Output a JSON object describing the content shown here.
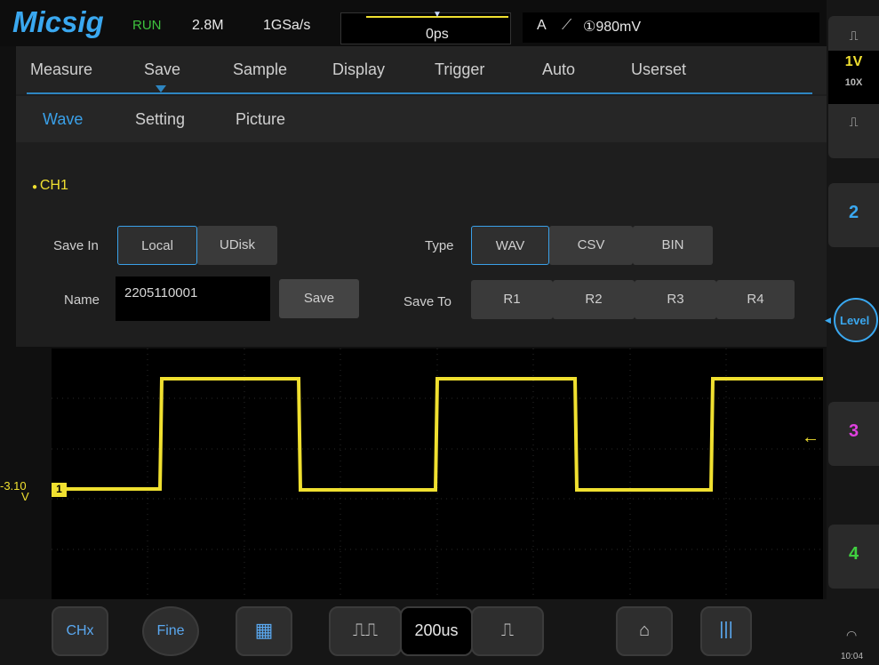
{
  "status": {
    "brand": "Micsig",
    "run_state": "RUN",
    "memory_depth": "2.8M",
    "sample_rate": "1GSa/s",
    "time_offset": "0ps",
    "trigger_source": "A",
    "trigger_level": "①980mV"
  },
  "menu": {
    "tabs": [
      "Measure",
      "Save",
      "Sample",
      "Display",
      "Trigger",
      "Auto",
      "Userset"
    ],
    "subtabs": [
      "Wave",
      "Setting",
      "Picture"
    ]
  },
  "save_panel": {
    "channel": "CH1",
    "save_in_label": "Save In",
    "save_in_options": [
      "Local",
      "UDisk"
    ],
    "type_label": "Type",
    "type_options": [
      "WAV",
      "CSV",
      "BIN"
    ],
    "name_label": "Name",
    "name_value": "2205110001",
    "save_button": "Save",
    "save_to_label": "Save To",
    "save_to_options": [
      "R1",
      "R2",
      "R3",
      "R4"
    ]
  },
  "waveform": {
    "offset_label_value": "-3.10",
    "offset_label_unit": "V",
    "channel_marker": "1",
    "color": "#f0e030"
  },
  "right_panel": {
    "ch1_scale": "1V",
    "ch1_probe": "10X",
    "ch2": "2",
    "level": "Level",
    "ch3": "3",
    "ch4": "4",
    "ch2_color": "#3aa8f0",
    "ch3_color": "#e040e0",
    "ch4_color": "#40d040",
    "clock": "10:04"
  },
  "bottom": {
    "chx": "CHx",
    "fine": "Fine",
    "timebase": "200us"
  }
}
